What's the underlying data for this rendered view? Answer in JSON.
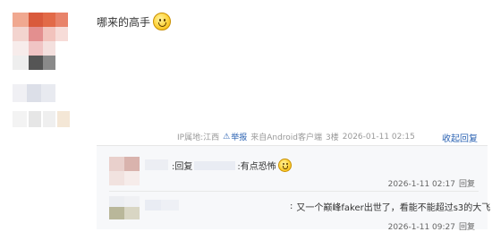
{
  "post": {
    "text": "哪来的高手",
    "emoji": "smiley-face-icon"
  },
  "meta": {
    "ip": "IP属地:江西",
    "report_label": "举报",
    "source": "来自Android客户端",
    "floor": "3楼",
    "datetime": "2026-01-11 02:15",
    "collapse_label": "收起回复"
  },
  "replies": [
    {
      "prefix": ":回复",
      "text": ":有点恐怖",
      "emoji": "smiley-face-icon",
      "time": "2026-1-11 02:17",
      "reply_label": "回复"
    },
    {
      "prefix": ":",
      "text": "又一个巅峰faker出世了，看能不能超过s3的大飞",
      "time": "2026-1-11 09:27",
      "reply_label": "回复"
    }
  ],
  "colors": {
    "link": "#2d64b3",
    "meta_text": "#999999",
    "reply_bg": "#f7f8fa"
  }
}
